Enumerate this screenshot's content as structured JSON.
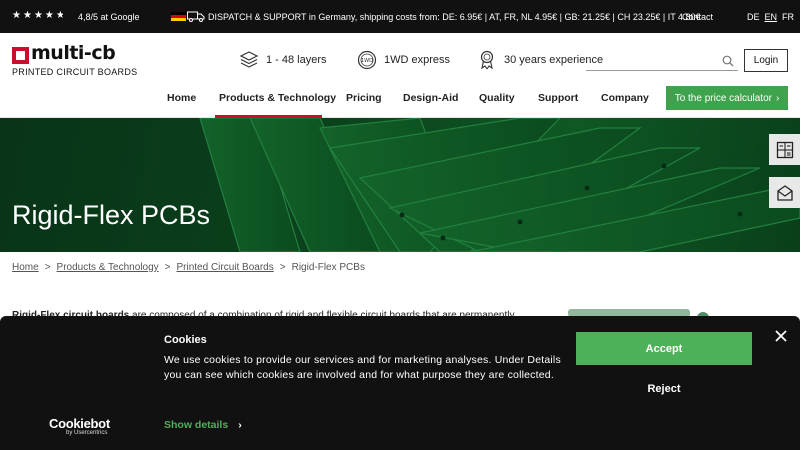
{
  "topbar": {
    "rating": "4,8/5 at Google",
    "rating_value": 4.8,
    "rating_max": 5,
    "shipping": "DISPATCH & SUPPORT in Germany, shipping costs from: DE: 6.95€ | AT, FR, NL 4.95€ | GB: 21.25€ | CH 23.25€ | IT 4.80€",
    "contact": "Contact",
    "languages": [
      "DE",
      "EN",
      "FR"
    ],
    "active_language": "EN"
  },
  "logo": {
    "name": "multi-cb",
    "tagline": "PRINTED CIRCUIT BOARDS"
  },
  "features": [
    {
      "icon": "layers-icon",
      "label": "1 - 48 layers"
    },
    {
      "icon": "express-icon",
      "label": "1WD express"
    },
    {
      "icon": "award-icon",
      "label": "30 years experience"
    }
  ],
  "search": {
    "placeholder": "",
    "icon": "search-icon"
  },
  "login_label": "Login",
  "nav": {
    "items": [
      "Home",
      "Products & Technology",
      "Pricing",
      "Design-Aid",
      "Quality",
      "Support",
      "Company"
    ],
    "active": "Products & Technology",
    "cta_label": "To the price calculator",
    "cta_icon": "chevron-right-icon"
  },
  "hero": {
    "title": "Rigid-Flex PCBs",
    "side_tabs": [
      "calculator-icon",
      "mail-icon"
    ]
  },
  "breadcrumb": [
    "Home",
    "Products & Technology",
    "Printed Circuit Boards",
    "Rigid-Flex PCBs"
  ],
  "intro": {
    "bold": "Rigid-Flex circuit boards",
    "text": " are composed of a combination of rigid and flexible circuit boards that are permanently"
  },
  "cookie": {
    "title": "Cookies",
    "body": "We use cookies to provide our services and for marketing analyses. Under Details you can see which cookies are involved and for what purpose they are collected.",
    "details_label": "Show details",
    "accept_label": "Accept",
    "reject_label": "Reject",
    "brand": "Cookiebot",
    "brand_sub": "by Usercentrics"
  },
  "colors": {
    "accent_red": "#c8102e",
    "cta_green": "#3fa34d",
    "cookie_green": "#4fb05a",
    "topbar_bg": "#111111"
  }
}
